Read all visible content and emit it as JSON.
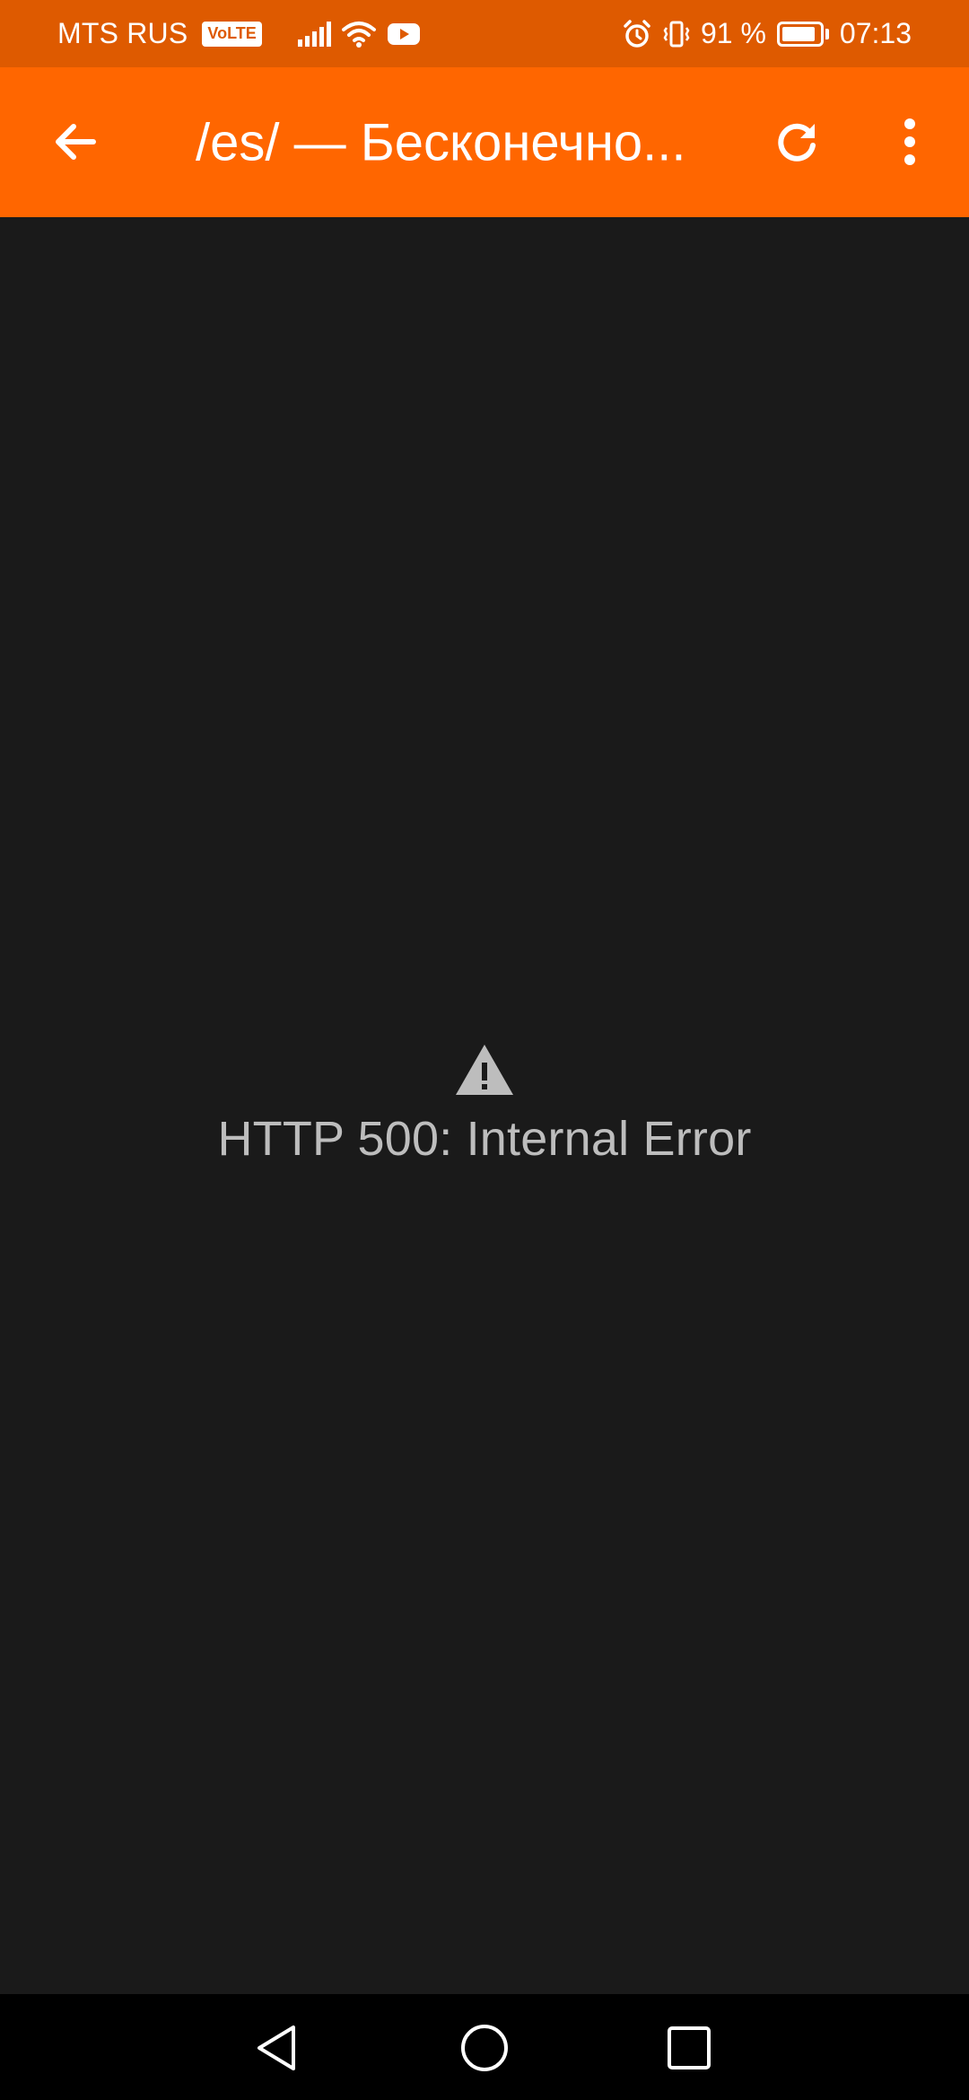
{
  "status_bar": {
    "carrier": "MTS RUS",
    "volte": "VoLTE",
    "battery_percent_text": "91 %",
    "battery_level": 0.91,
    "time": "07:13",
    "icons": [
      "signal-icon",
      "wifi-icon",
      "youtube-icon",
      "alarm-icon",
      "vibrate-icon",
      "battery-icon"
    ]
  },
  "app_bar": {
    "title": "/es/ — Бесконечно...",
    "background": "#ff6600",
    "icons": [
      "back-arrow-icon",
      "refresh-icon",
      "more-vert-icon"
    ]
  },
  "content": {
    "error_icon": "warning-icon",
    "error_message": "HTTP 500: Internal Error",
    "background": "#1a1a1a"
  },
  "nav_bar": {
    "icons": [
      "nav-back-icon",
      "nav-home-icon",
      "nav-recents-icon"
    ]
  }
}
